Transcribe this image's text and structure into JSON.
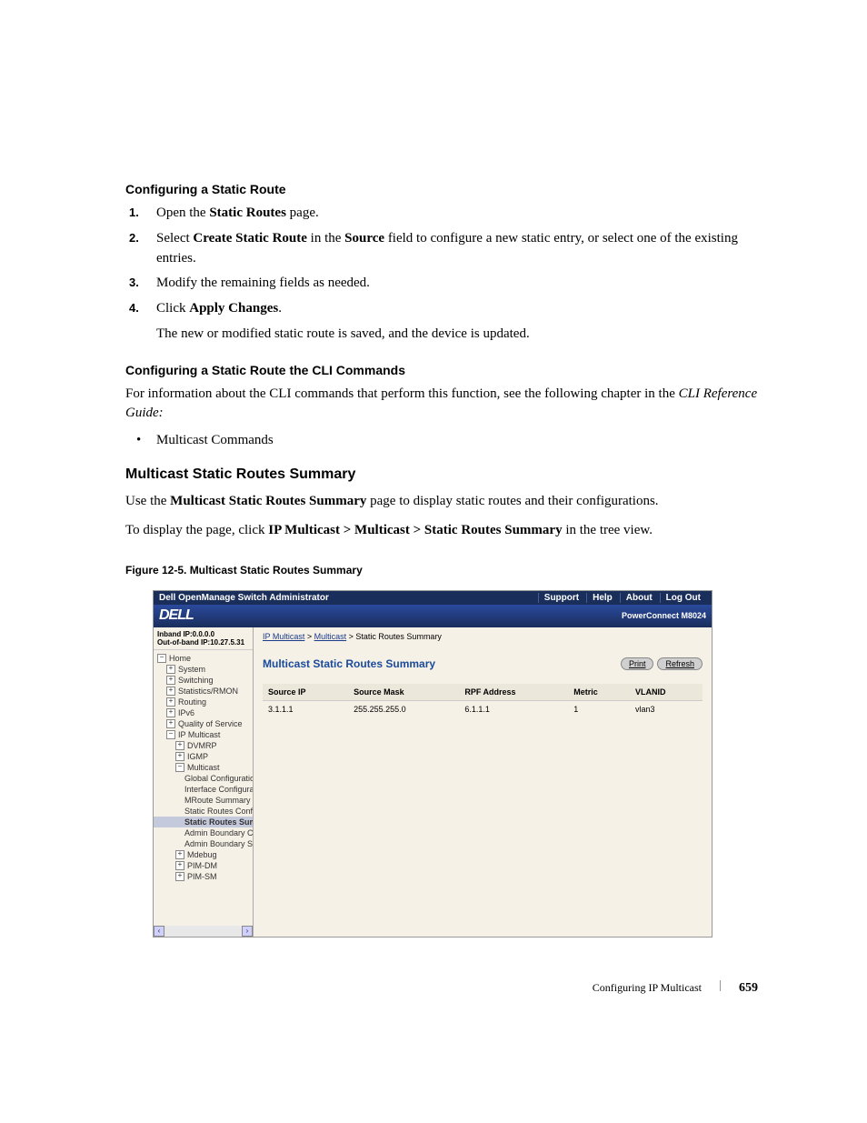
{
  "heading1": "Configuring a Static Route",
  "steps": {
    "s1a": "Open the ",
    "s1b": "Static Routes",
    "s1c": " page.",
    "s2a": "Select ",
    "s2b": "Create Static Route",
    "s2c": " in the ",
    "s2d": "Source",
    "s2e": " field to configure a new static entry, or select one of the existing entries.",
    "s3": "Modify the remaining fields as needed.",
    "s4a": "Click ",
    "s4b": "Apply Changes",
    "s4c": ".",
    "s4d": "The new or modified static route is saved, and the device is updated."
  },
  "nums": {
    "n1": "1.",
    "n2": "2.",
    "n3": "3.",
    "n4": "4."
  },
  "heading2": "Configuring a Static Route the CLI Commands",
  "cli_p1": "For information about the CLI commands that perform this function, see the following chapter in the ",
  "cli_p2": "CLI Reference Guide:",
  "cli_bullet": "Multicast Commands",
  "heading3": "Multicast Static Routes Summary",
  "p3a": "Use the ",
  "p3b": "Multicast Static Routes Summary",
  "p3c": " page to display static routes and their configurations.",
  "p4a": "To display the page, click ",
  "p4b": "IP Multicast > Multicast > Static Routes Summary",
  "p4c": " in the tree view.",
  "figure_caption": "Figure 12-5.    Multicast Static Routes Summary",
  "screenshot": {
    "top_title": "Dell OpenManage Switch Administrator",
    "top_links": {
      "support": "Support",
      "help": "Help",
      "about": "About",
      "logout": "Log Out"
    },
    "logo": "DELL",
    "model": "PowerConnect M8024",
    "ip1": "Inband IP:0.0.0.0",
    "ip2": "Out-of-band IP:10.27.5.31",
    "nav": {
      "home": "Home",
      "system": "System",
      "switching": "Switching",
      "stats": "Statistics/RMON",
      "routing": "Routing",
      "ipv6": "IPv6",
      "qos": "Quality of Service",
      "ipmc": "IP Multicast",
      "dvmrp": "DVMRP",
      "igmp": "IGMP",
      "multicast": "Multicast",
      "global": "Global Configuration",
      "iface": "Interface Configuration",
      "mroute": "MRoute Summary",
      "srconfig": "Static Routes Configu",
      "srsummary": "Static Routes Summ",
      "abcon": "Admin Boundary Con",
      "absum": "Admin Boundary Sum",
      "mdebug": "Mdebug",
      "pimdm": "PIM-DM",
      "pimsm": "PIM-SM"
    },
    "breadcrumb": {
      "a1": "IP Multicast",
      "a2": "Multicast",
      "tail": "Static Routes Summary"
    },
    "content_title": "Multicast Static Routes Summary",
    "btn_print": "Print",
    "btn_refresh": "Refresh",
    "table": {
      "h1": "Source IP",
      "h2": "Source Mask",
      "h3": "RPF Address",
      "h4": "Metric",
      "h5": "VLANID",
      "r1c1": "3.1.1.1",
      "r1c2": "255.255.255.0",
      "r1c3": "6.1.1.1",
      "r1c4": "1",
      "r1c5": "vlan3"
    }
  },
  "footer": {
    "title": "Configuring IP Multicast",
    "page": "659"
  }
}
